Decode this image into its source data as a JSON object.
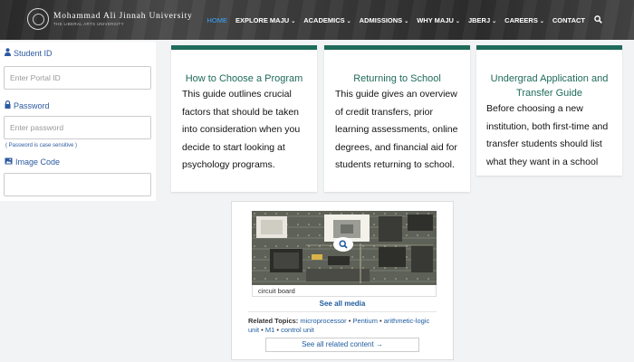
{
  "header": {
    "logo_name": "Mohammad Ali Jinnah University",
    "logo_tagline": "THE LIBERAL ARTS UNIVERSITY",
    "nav": [
      {
        "label": "HOME",
        "dropdown": false
      },
      {
        "label": "EXPLORE MAJU",
        "dropdown": true
      },
      {
        "label": "ACADEMICS",
        "dropdown": true
      },
      {
        "label": "ADMISSIONS",
        "dropdown": true
      },
      {
        "label": "WHY MAJU",
        "dropdown": true
      },
      {
        "label": "JBERJ",
        "dropdown": true
      },
      {
        "label": "CAREERS",
        "dropdown": true
      },
      {
        "label": "CONTACT",
        "dropdown": false
      }
    ],
    "nav_active_color": "#3aa6ff"
  },
  "login": {
    "student_id_label": "Student ID",
    "student_id_placeholder": "Enter Portal ID",
    "password_label": "Password",
    "password_placeholder": "Enter password",
    "password_hint": "( Password is case sensitive )",
    "image_code_label": "Image Code",
    "image_code_value": ""
  },
  "cards": [
    {
      "title": "How to Choose a Program",
      "body": "This guide outlines crucial factors that should be taken into consideration when you decide to start looking at psychology programs."
    },
    {
      "title": "Returning to School",
      "body": "This guide gives an overview of credit transfers, prior learning assessments, online degrees, and financial aid for students returning to school."
    },
    {
      "title": "Undergrad Application and Transfer Guide",
      "body": "Before choosing a new institution, both first-time and transfer students should list what they want in a school"
    }
  ],
  "card_accent": "#1f6b5a",
  "media": {
    "caption": "circuit board",
    "see_all_media": "See all media",
    "related_label": "Related Topics:",
    "related_topics": [
      "microprocessor",
      "Pentium",
      "arithmetic-logic unit",
      "M1",
      "control unit"
    ],
    "see_all_related": "See all related content →"
  }
}
